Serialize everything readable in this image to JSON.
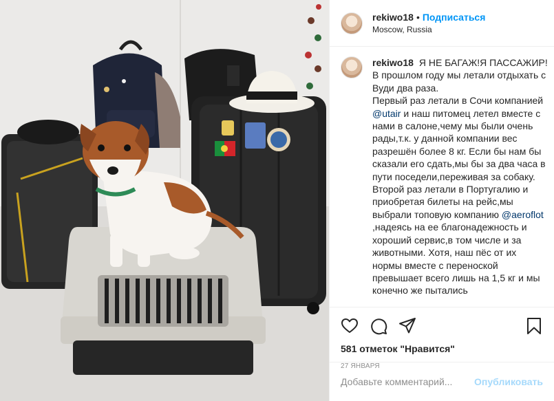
{
  "header": {
    "username": "rekiwo18",
    "separator": "•",
    "follow_label": "Подписаться",
    "location": "Moscow, Russia"
  },
  "caption": {
    "username": "rekiwo18",
    "p1": "Я НЕ БАГАЖ!Я ПАССАЖИР! В прошлом году мы летали отдыхать с Вуди два раза.",
    "p2a": "Первый раз летали в Сочи компанией",
    "m1": "@utair",
    "p2b": "и наш питомец летел вместе с нами в салоне,чему мы были очень рады,т.к. у данной компании вес разрешён более 8 кг. Если бы нам бы сказали его сдать,мы бы за два часа в пути поседели,переживая за собаку.",
    "p3a": "Второй раз летали в Португалию и приобретая билеты на рейс,мы выбрали топовую компанию",
    "m2": "@aeroflot",
    "p3b": ",надеясь на ее благонадежность и хороший сервис,в том числе и за животными. Хотя, наш пёс от их нормы вместе с переноской превышает всего лишь на 1,5 кг и мы конечно же пытались"
  },
  "actions": {
    "icons": [
      "heart-icon",
      "comment-icon",
      "share-icon",
      "bookmark-icon"
    ],
    "likes": "581 отметок \"Нравится\"",
    "date": "27 января"
  },
  "comment": {
    "placeholder": "Добавьте комментарий...",
    "publish_label": "Опубликовать"
  },
  "colors": {
    "accent": "#0095f6",
    "text": "#262626",
    "muted": "#8e8e8e",
    "border": "#efefef"
  }
}
